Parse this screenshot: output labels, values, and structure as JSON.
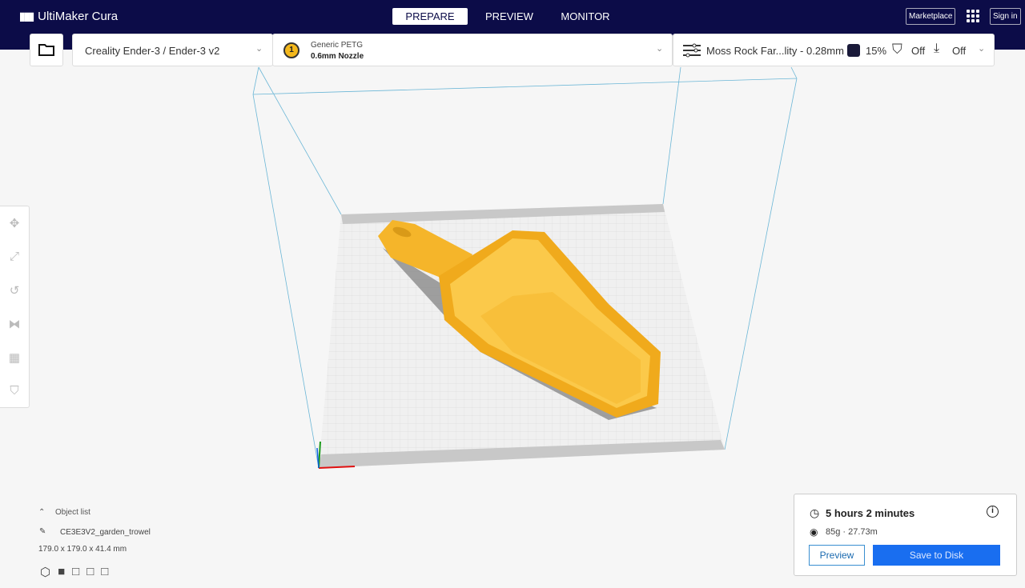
{
  "app": {
    "title": "UltiMaker Cura"
  },
  "tabs": [
    {
      "label": "PREPARE",
      "active": true
    },
    {
      "label": "PREVIEW"
    },
    {
      "label": "MONITOR"
    }
  ],
  "header": {
    "marketplace": "Marketplace",
    "sign_in": "Sign in"
  },
  "printer": {
    "name": "Creality Ender-3 / Ender-3 v2"
  },
  "extruder": {
    "number": "1",
    "material": "Generic PETG",
    "nozzle": "0.6mm Nozzle"
  },
  "settings": {
    "profile": "Moss Rock Far...lity - 0.28mm",
    "infill": "15%",
    "support": "Off",
    "adhesion": "Off"
  },
  "object_list": {
    "label": "Object list",
    "object_name": "CE3E3V2_garden_trowel",
    "dimensions": "179.0 x 179.0 x 41.4 mm"
  },
  "estimate": {
    "time": "5 hours 2 minutes",
    "material": "85g · 27.73m",
    "preview_label": "Preview",
    "save_label": "Save to Disk"
  },
  "colors": {
    "header": "#0c0c48",
    "accent": "#196ef0",
    "model": "#f9c33a"
  }
}
